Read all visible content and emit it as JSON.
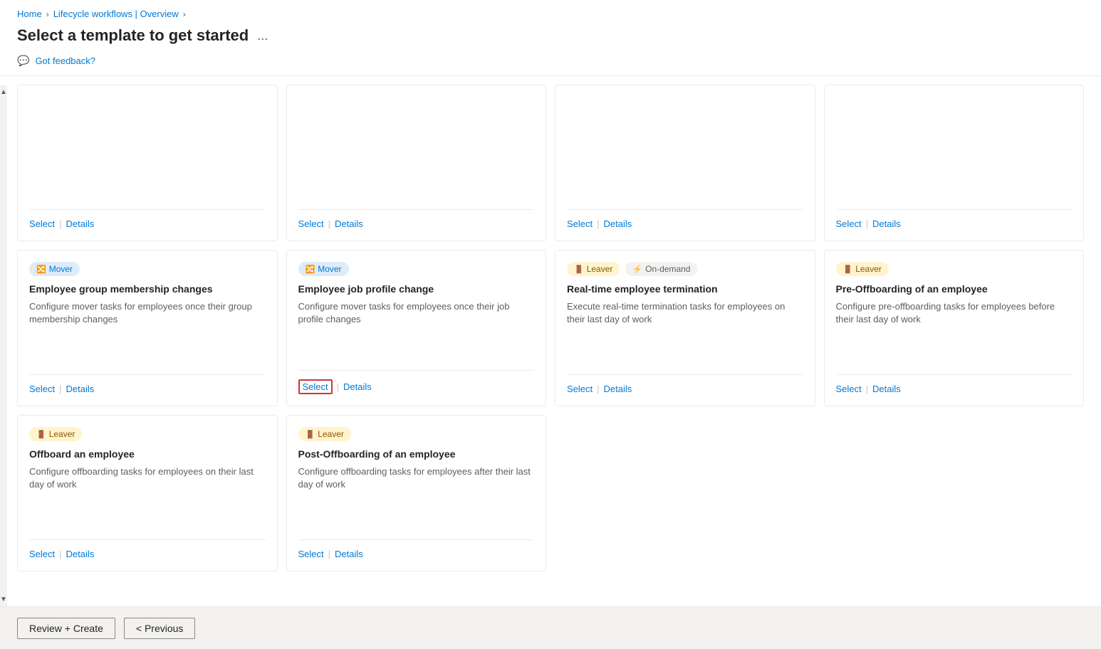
{
  "breadcrumb": {
    "items": [
      {
        "label": "Home",
        "href": "#"
      },
      {
        "label": "Lifecycle workflows | Overview",
        "href": "#"
      }
    ]
  },
  "page": {
    "title": "Select a template to get started",
    "ellipsis": "...",
    "feedback_label": "Got feedback?"
  },
  "cards": [
    {
      "id": "card-1",
      "badges": [],
      "title": "",
      "description": "",
      "select_label": "Select",
      "details_label": "Details",
      "select_highlighted": false
    },
    {
      "id": "card-2",
      "badges": [],
      "title": "",
      "description": "",
      "select_label": "Select",
      "details_label": "Details",
      "select_highlighted": false
    },
    {
      "id": "card-3",
      "badges": [],
      "title": "",
      "description": "",
      "select_label": "Select",
      "details_label": "Details",
      "select_highlighted": false
    },
    {
      "id": "card-4",
      "badges": [],
      "title": "",
      "description": "",
      "select_label": "Select",
      "details_label": "Details",
      "select_highlighted": false
    },
    {
      "id": "card-5",
      "badges": [
        {
          "type": "mover",
          "label": "Mover"
        }
      ],
      "title": "Employee group membership changes",
      "description": "Configure mover tasks for employees once their group membership changes",
      "select_label": "Select",
      "details_label": "Details",
      "select_highlighted": false
    },
    {
      "id": "card-6",
      "badges": [
        {
          "type": "mover",
          "label": "Mover"
        }
      ],
      "title": "Employee job profile change",
      "description": "Configure mover tasks for employees once their job profile changes",
      "select_label": "Select",
      "details_label": "Details",
      "select_highlighted": true
    },
    {
      "id": "card-7",
      "badges": [
        {
          "type": "leaver",
          "label": "Leaver"
        },
        {
          "type": "ondemand",
          "label": "On-demand"
        }
      ],
      "title": "Real-time employee termination",
      "description": "Execute real-time termination tasks for employees on their last day of work",
      "select_label": "Select",
      "details_label": "Details",
      "select_highlighted": false
    },
    {
      "id": "card-8",
      "badges": [
        {
          "type": "leaver",
          "label": "Leaver"
        }
      ],
      "title": "Pre-Offboarding of an employee",
      "description": "Configure pre-offboarding tasks for employees before their last day of work",
      "select_label": "Select",
      "details_label": "Details",
      "select_highlighted": false
    },
    {
      "id": "card-9",
      "badges": [
        {
          "type": "leaver",
          "label": "Leaver"
        }
      ],
      "title": "Offboard an employee",
      "description": "Configure offboarding tasks for employees on their last day of work",
      "select_label": "Select",
      "details_label": "Details",
      "select_highlighted": false
    },
    {
      "id": "card-10",
      "badges": [
        {
          "type": "leaver",
          "label": "Leaver"
        }
      ],
      "title": "Post-Offboarding of an employee",
      "description": "Configure offboarding tasks for employees after their last day of work",
      "select_label": "Select",
      "details_label": "Details",
      "select_highlighted": false
    }
  ],
  "bottom_bar": {
    "review_create_label": "Review + Create",
    "previous_label": "< Previous"
  },
  "badge_icons": {
    "mover": "🔀",
    "leaver": "🚪",
    "joiner": "➕",
    "ondemand": "⚡"
  }
}
